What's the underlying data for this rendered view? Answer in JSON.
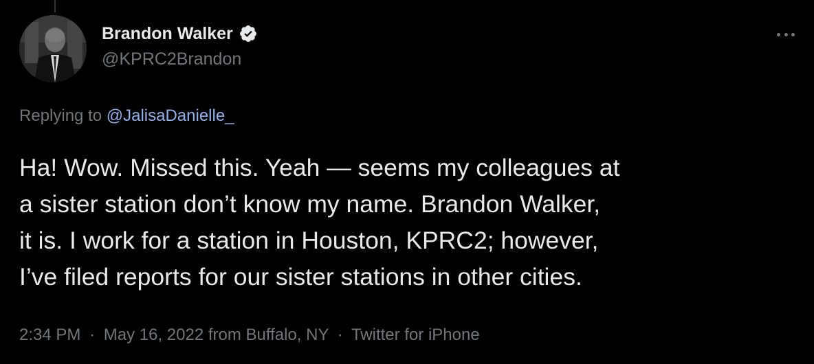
{
  "tweet": {
    "author": {
      "display_name": "Brandon Walker",
      "handle": "@KPRC2Brandon",
      "verified": true,
      "avatar_icon": "profile-photo"
    },
    "reply": {
      "prefix": "Replying to",
      "mention": "@JalisaDanielle_"
    },
    "text": "Ha! Wow. Missed this. Yeah — seems my colleagues at\na sister station don’t know my name. Brandon Walker,\nit is. I work for a station in Houston, KPRC2; however,\nI’ve filed reports for our sister stations in other cities.",
    "meta": {
      "time": "2:34 PM",
      "separator": "·",
      "date_location": "May 16, 2022 from Buffalo, NY",
      "source": "Twitter for iPhone"
    },
    "more_icon": "more-horizontal-icon",
    "verified_icon": "verified-badge-icon"
  },
  "colors": {
    "background": "#000000",
    "primary_text": "#e7e9ea",
    "secondary_text": "#71767b",
    "link": "#8fb3ee"
  }
}
